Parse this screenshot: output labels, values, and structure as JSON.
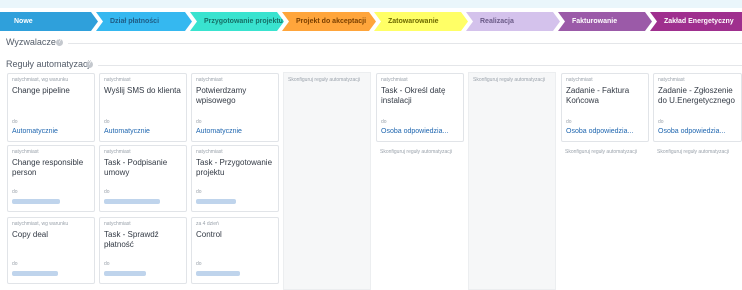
{
  "stages": [
    {
      "label": "Nowe",
      "bg": "#2fa0db",
      "fg": "#ffffff"
    },
    {
      "label": "Dział płatności",
      "bg": "#35b8f0",
      "fg": "#1f5c85"
    },
    {
      "label": "Przygotowanie projektu",
      "bg": "#39e3cf",
      "fg": "#166f66"
    },
    {
      "label": "Projekt do akceptacji",
      "bg": "#ffa53b",
      "fg": "#7a3f00"
    },
    {
      "label": "Zatowarowanie",
      "bg": "#ffff66",
      "fg": "#6e6a00"
    },
    {
      "label": "Realizacja",
      "bg": "#d4c2ec",
      "fg": "#6a5a86"
    },
    {
      "label": "Fakturowanie",
      "bg": "#9b5aa8",
      "fg": "#ffffff"
    },
    {
      "label": "Zakład Energetyczny",
      "bg": "#9f2f8e",
      "fg": "#ffffff"
    }
  ],
  "sections": {
    "triggers": "Wyzwalacze",
    "automation": "Reguły automatyzacji"
  },
  "configure_label": "Skonfiguruj reguły automatyzacji",
  "cards": [
    {
      "cond": "natychmiast, wg warunku",
      "title": "Change pipeline",
      "do": "do",
      "resp": "Automatycznie"
    },
    {
      "cond": "natychmiast",
      "title": "Wyślij SMS do klienta",
      "do": "do",
      "resp": "Automatycznie"
    },
    {
      "cond": "natychmiast",
      "title": "Potwierdzamy wpisowego",
      "do": "do",
      "resp": "Automatycznie"
    },
    {
      "cond": "natychmiast",
      "title": "Task - Określ datę instalacji",
      "do": "do",
      "resp": "Osoba odpowiedzia..."
    },
    {
      "cond": "natychmiast",
      "title": "Zadanie - Faktura Końcowa",
      "do": "do",
      "resp": "Osoba odpowiedzia..."
    },
    {
      "cond": "natychmiast",
      "title": "Zadanie - Zgłoszenie do U.Energetycznego",
      "do": "do",
      "resp": "Osoba odpowiedzia..."
    },
    {
      "cond": "natychmiast",
      "title": "Change responsible person",
      "do": "do"
    },
    {
      "cond": "natychmiast",
      "title": "Task - Podpisanie umowy",
      "do": "do"
    },
    {
      "cond": "natychmiast",
      "title": "Task - Przygotowanie projektu",
      "do": "do"
    },
    {
      "cond": "natychmiast, wg warunku",
      "title": "Copy deal",
      "do": "do"
    },
    {
      "cond": "natychmiast",
      "title": "Task - Sprawdź płatność",
      "do": "do"
    },
    {
      "cond": "za 4 dzień",
      "title": "Control",
      "do": "do"
    }
  ]
}
